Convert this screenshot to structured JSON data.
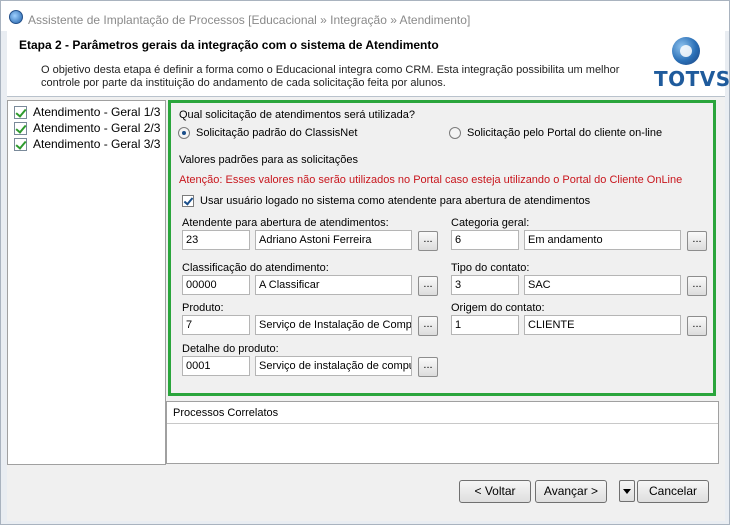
{
  "window": {
    "title": "Assistente de Implantação de Processos [Educacional » Integração » Atendimento]"
  },
  "header": {
    "title": "Etapa 2 - Parâmetros gerais da integração com o sistema de Atendimento",
    "description": "O objetivo desta etapa é definir a forma como o Educacional integra como CRM. Esta integração possibilita um melhor controle por parte da instituição do andamento de cada solicitação feita por alunos.",
    "logo_text": "TOTVS",
    "logo_color": "#1f5b9c"
  },
  "steps": [
    {
      "label": "Atendimento - Geral 1/3",
      "checked": true
    },
    {
      "label": "Atendimento - Geral 2/3",
      "checked": true
    },
    {
      "label": "Atendimento - Geral 3/3",
      "checked": true
    }
  ],
  "form": {
    "question": "Qual solicitação de atendimentos será utilizada?",
    "option_standard": "Solicitação padrão do ClassisNet",
    "option_portal": "Solicitação pelo Portal do cliente on-line",
    "selected_option": "Solicitação padrão do ClassisNet",
    "defaults_title": "Valores padrões para as solicitações",
    "warning": "Atenção: Esses valores não serão utilizados no Portal caso esteja utilizando o Portal do Cliente OnLine",
    "warning_color": "#c8161d",
    "use_logged_user_label": "Usar usuário logado no sistema como atendente para abertura de atendimentos",
    "use_logged_user_checked": true,
    "browse_label": "...",
    "atendente": {
      "label": "Atendente para abertura de atendimentos:",
      "code": "23",
      "name": "Adriano Astoni Ferreira"
    },
    "categoria": {
      "label": "Categoria geral:",
      "code": "6",
      "name": "Em andamento"
    },
    "classificacao": {
      "label": "Classificação do atendimento:",
      "code": "00000",
      "name": "A Classificar"
    },
    "tipo_contato": {
      "label": "Tipo do contato:",
      "code": "3",
      "name": "SAC"
    },
    "produto": {
      "label": "Produto:",
      "code": "7",
      "name": "Serviço de Instalação de Compu"
    },
    "origem_contato": {
      "label": "Origem do contato:",
      "code": "1",
      "name": "CLIENTE"
    },
    "detalhe_produto": {
      "label": "Detalhe do produto:",
      "code": "0001",
      "name": "Serviço de instalação de compu"
    },
    "frame_color": "#2aa53c"
  },
  "related": {
    "title": "Processos Correlatos"
  },
  "footer": {
    "back_label": "< Voltar",
    "next_label": "Avançar >",
    "cancel_label": "Cancelar"
  }
}
